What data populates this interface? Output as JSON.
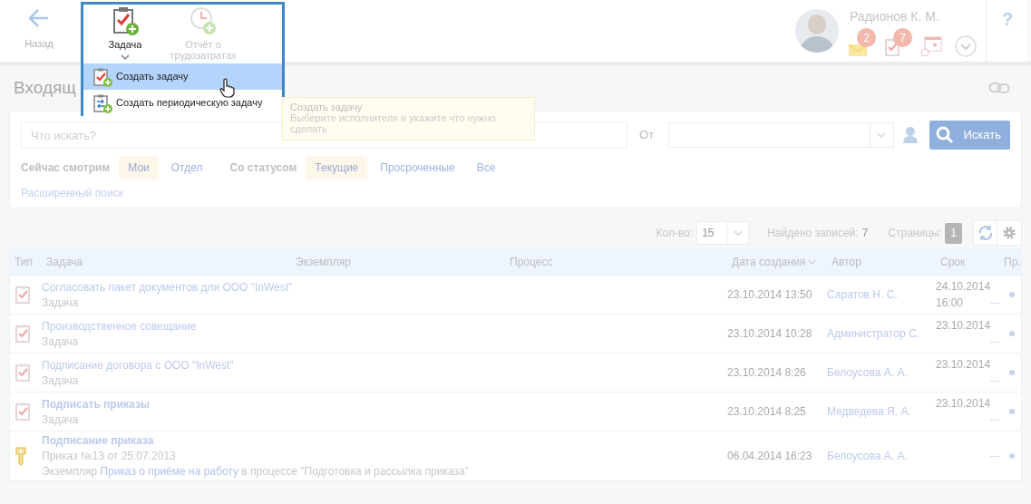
{
  "header": {
    "back": "Назад",
    "user_name": "Радионов К. М.",
    "mail_badge": "2",
    "tasks_badge": "7",
    "help": "?"
  },
  "create_menu": {
    "buttons": [
      {
        "label": "Задача",
        "kind": "task",
        "active": true
      },
      {
        "label": "Отчёт о трудозатратах",
        "kind": "report",
        "active": false
      }
    ],
    "items": [
      {
        "label": "Создать задачу",
        "kind": "task",
        "selected": true
      },
      {
        "label": "Создать периодическую задачу",
        "kind": "periodic",
        "selected": false
      }
    ]
  },
  "tooltip": {
    "title": "Создать задачу",
    "text": "Выберите исполнителя и укажите что нужно сделать"
  },
  "page_title": "Входящ",
  "filters": {
    "search_placeholder": "Что искать?",
    "from_label": "От",
    "search_button": "Искать",
    "view_label": "Сейчас смотрим",
    "view_options": [
      {
        "label": "Мои",
        "selected": true
      },
      {
        "label": "Отдел",
        "selected": false
      }
    ],
    "status_label": "Со статусом",
    "status_options": [
      {
        "label": "Текущие",
        "selected": true
      },
      {
        "label": "Просроченные",
        "selected": false
      },
      {
        "label": "Все",
        "selected": false
      }
    ],
    "advanced": "Расширенный поиск"
  },
  "toolbar": {
    "count_label": "Кол-во:",
    "count_value": "15",
    "found_label": "Найдено записей:",
    "found_value": "7",
    "pages_label": "Страницы:",
    "page": "1"
  },
  "table": {
    "columns": [
      "Тип",
      "Задача",
      "Экземпляр",
      "Процесс",
      "Дата создания",
      "Автор",
      "Срок",
      "Пр."
    ],
    "rows": [
      {
        "kind": "task",
        "title": "Согласовать пакет документов для ООО \"InWest\"",
        "bold": false,
        "subtitle": "Задача",
        "created": "23.10.2014 13:50",
        "author": "Саратов Н. С.",
        "due": "24.10.2014",
        "due_time": "16:00",
        "due_extra": "---"
      },
      {
        "kind": "task",
        "title": "Производственное совещание",
        "bold": false,
        "subtitle": "Задача",
        "created": "23.10.2014 10:28",
        "author": "Администратор С.",
        "due": "23.10.2014",
        "due_extra": "---"
      },
      {
        "kind": "task",
        "title": "Подписание договора с ООО \"InWest\"",
        "bold": false,
        "subtitle": "Задача",
        "created": "23.10.2014 8:26",
        "author": "Белоусова А. А.",
        "due": "23.10.2014",
        "due_extra": "---"
      },
      {
        "kind": "task",
        "title": "Подписать приказы",
        "bold": true,
        "subtitle": "Задача",
        "created": "23.10.2014 8:25",
        "author": "Медведева Я. А.",
        "due": "23.10.2014",
        "due_extra": "---"
      },
      {
        "kind": "key",
        "title": "Подписание приказа",
        "bold": true,
        "subtitle": "Приказ №13 от 25.07.2013",
        "instance_prefix": "Экземпляр",
        "instance_link": "Приказ о приёме на работу",
        "instance_suffix": "в процессе \"Подготовка и рассылка приказа\"",
        "created": "06.04.2014 16:23",
        "author": "Белоусова А. А.",
        "due_extra": "---"
      }
    ]
  }
}
